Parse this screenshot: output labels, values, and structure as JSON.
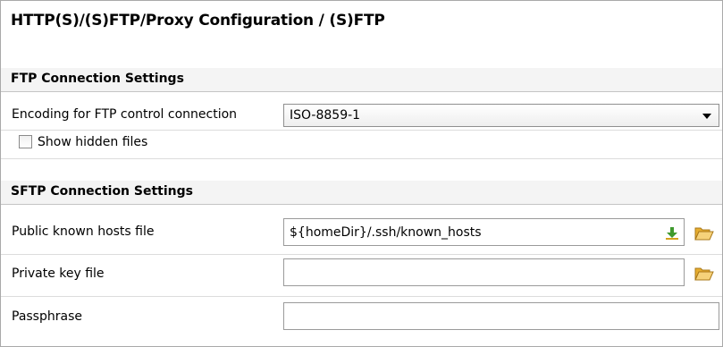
{
  "page": {
    "title": "HTTP(S)/(S)FTP/Proxy Configuration / (S)FTP"
  },
  "ftp": {
    "section_title": "FTP Connection Settings",
    "encoding_label": "Encoding for FTP control connection",
    "encoding_value": "ISO-8859-1",
    "show_hidden_label": "Show hidden files",
    "show_hidden_checked": false
  },
  "sftp": {
    "section_title": "SFTP Connection Settings",
    "known_hosts_label": "Public known hosts file",
    "known_hosts_value": "${homeDir}/.ssh/known_hosts",
    "private_key_label": "Private key file",
    "private_key_value": "",
    "passphrase_label": "Passphrase",
    "passphrase_value": ""
  },
  "icons": {
    "download": "download-icon",
    "folder": "folder-open-icon"
  },
  "colors": {
    "section_bg": "#f4f4f4",
    "folder": "#f2c14e",
    "download_arrow": "#3f9a2e"
  }
}
